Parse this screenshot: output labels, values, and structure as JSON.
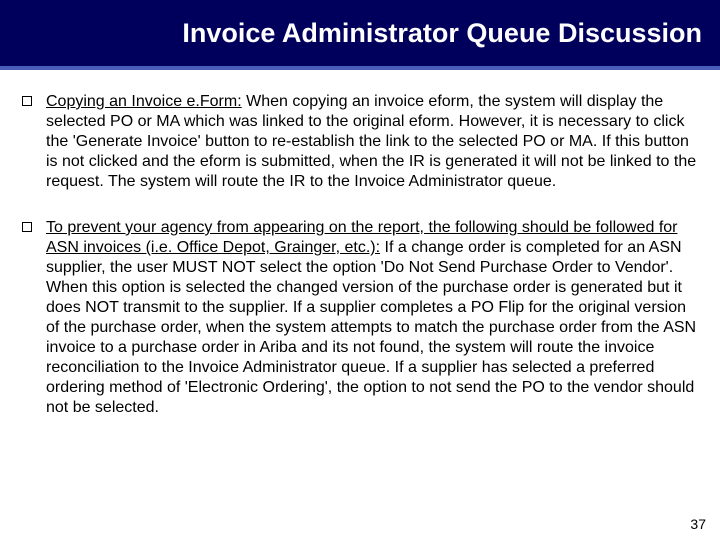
{
  "title": "Invoice Administrator Queue Discussion",
  "bullets": [
    {
      "lead": "Copying an Invoice e.Form:",
      "rest": " When copying an invoice eform, the system will display the selected PO or MA which was linked to the original eform.  However, it is necessary to click the 'Generate Invoice' button to re-establish the link to the selected PO or MA.  If this button is not clicked and the eform is submitted, when the IR is generated it will not be linked to the request.  The system will route the IR to the Invoice Administrator queue."
    },
    {
      "lead": "To prevent your agency from appearing on the report, the following should be followed for ASN invoices  (i.e. Office Depot, Grainger, etc.):",
      "rest": "  If a change order is completed for an ASN supplier, the user MUST NOT select the option 'Do Not Send Purchase Order to Vendor'.  When this option is selected the changed version of the purchase order is generated but it does NOT transmit to the supplier.  If a supplier completes a PO Flip for the original version of the purchase order, when the system attempts to match the purchase order from the ASN invoice to a purchase order in Ariba and its not found, the system will route the invoice reconciliation to the Invoice Administrator queue.  If a supplier has selected a preferred ordering method of 'Electronic Ordering', the option to not send the PO to the vendor should not be selected."
    }
  ],
  "page_number": "37"
}
